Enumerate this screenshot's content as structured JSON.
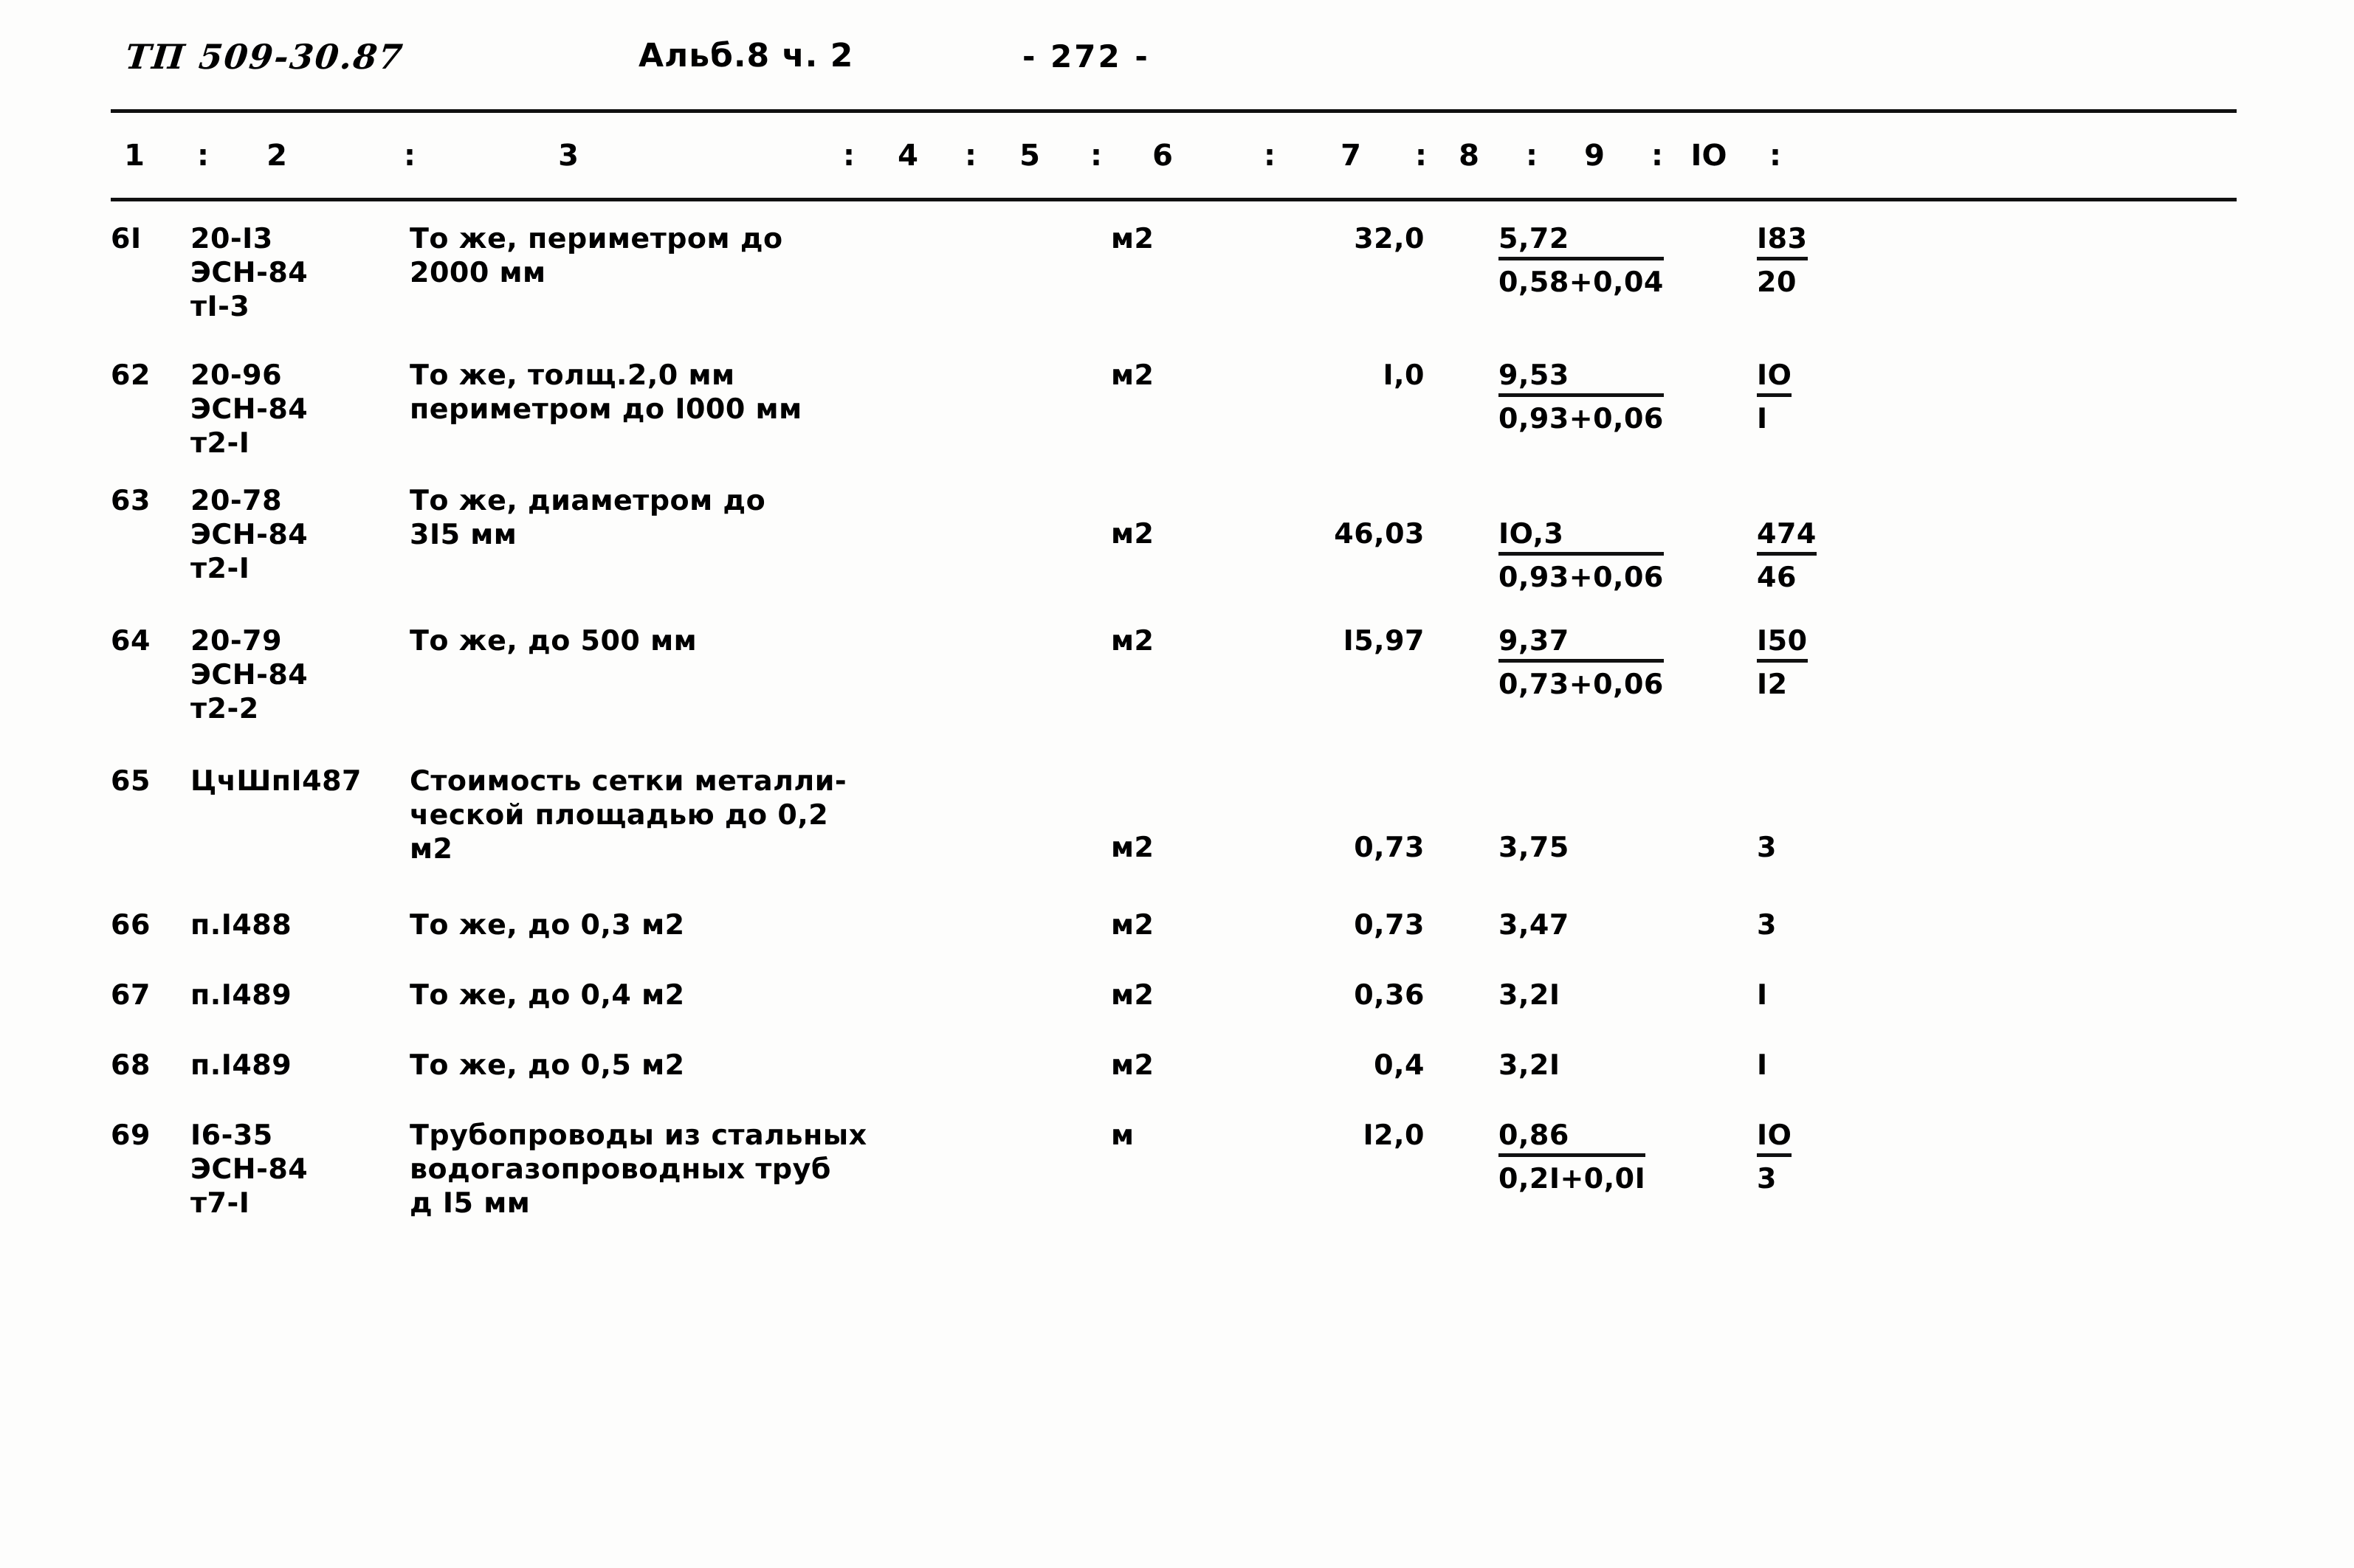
{
  "header": {
    "document_code": "ТП 509-30.87",
    "album": "Альб.8 ч. 2",
    "page_number": "- 272 -"
  },
  "column_numbers": [
    "1",
    "2",
    "3",
    "4",
    "5",
    "6",
    "7",
    "8",
    "9",
    "IO"
  ],
  "column_separator": ":",
  "rows": [
    {
      "num": "6I",
      "code_lines": [
        "20-I3",
        "ЭСН-84",
        "тI-3"
      ],
      "desc_lines": [
        "То же, периметром до",
        "2000 мм"
      ],
      "unit": "м2",
      "qty": "32,0",
      "price_numerator": "5,72",
      "price_denominator": "0,58+0,04",
      "total_numerator": "I83",
      "total_denominator": "20"
    },
    {
      "num": "62",
      "code_lines": [
        "20-96",
        "ЭСН-84",
        "т2-I"
      ],
      "desc_lines": [
        "То же, толщ.2,0 мм",
        "периметром до I000 мм"
      ],
      "unit": "м2",
      "qty": "I,0",
      "price_numerator": "9,53",
      "price_denominator": "0,93+0,06",
      "total_numerator": "IO",
      "total_denominator": "I"
    },
    {
      "num": "63",
      "code_lines": [
        "20-78",
        "ЭСН-84",
        "т2-I"
      ],
      "desc_lines": [
        "То же, диаметром до",
        "3I5 мм"
      ],
      "unit": "м2",
      "qty": "46,03",
      "price_numerator": "IO,3",
      "price_denominator": "0,93+0,06",
      "total_numerator": "474",
      "total_denominator": "46"
    },
    {
      "num": "64",
      "code_lines": [
        "20-79",
        "ЭСН-84",
        "т2-2"
      ],
      "desc_lines": [
        "То же, до 500 мм"
      ],
      "unit": "м2",
      "qty": "I5,97",
      "price_numerator": "9,37",
      "price_denominator": "0,73+0,06",
      "total_numerator": "I50",
      "total_denominator": "I2"
    },
    {
      "num": "65",
      "code_lines": [
        "ЦчШпI487"
      ],
      "desc_lines": [
        "Стоимость сетки металли-",
        "ческой площадью до 0,2",
        "м2"
      ],
      "unit": "м2",
      "qty": "0,73",
      "price_numerator": "3,75",
      "price_denominator": "",
      "total_numerator": "3",
      "total_denominator": ""
    },
    {
      "num": "66",
      "code_lines": [
        "п.I488"
      ],
      "desc_lines": [
        "То же, до 0,3 м2"
      ],
      "unit": "м2",
      "qty": "0,73",
      "price_numerator": "3,47",
      "price_denominator": "",
      "total_numerator": "3",
      "total_denominator": ""
    },
    {
      "num": "67",
      "code_lines": [
        "п.I489"
      ],
      "desc_lines": [
        "То же, до 0,4 м2"
      ],
      "unit": "м2",
      "qty": "0,36",
      "price_numerator": "3,2I",
      "price_denominator": "",
      "total_numerator": "I",
      "total_denominator": ""
    },
    {
      "num": "68",
      "code_lines": [
        "п.I489"
      ],
      "desc_lines": [
        "То же, до 0,5 м2"
      ],
      "unit": "м2",
      "qty": "0,4",
      "price_numerator": "3,2I",
      "price_denominator": "",
      "total_numerator": "I",
      "total_denominator": ""
    },
    {
      "num": "69",
      "code_lines": [
        "I6-35",
        "ЭСН-84",
        "т7-I"
      ],
      "desc_lines": [
        "Трубопроводы из стальных",
        "водогазопроводных труб",
        "д I5 мм"
      ],
      "unit": "м",
      "qty": "I2,0",
      "price_numerator": "0,86",
      "price_denominator": "0,2I+0,0I",
      "total_numerator": "IO",
      "total_denominator": "3"
    }
  ]
}
